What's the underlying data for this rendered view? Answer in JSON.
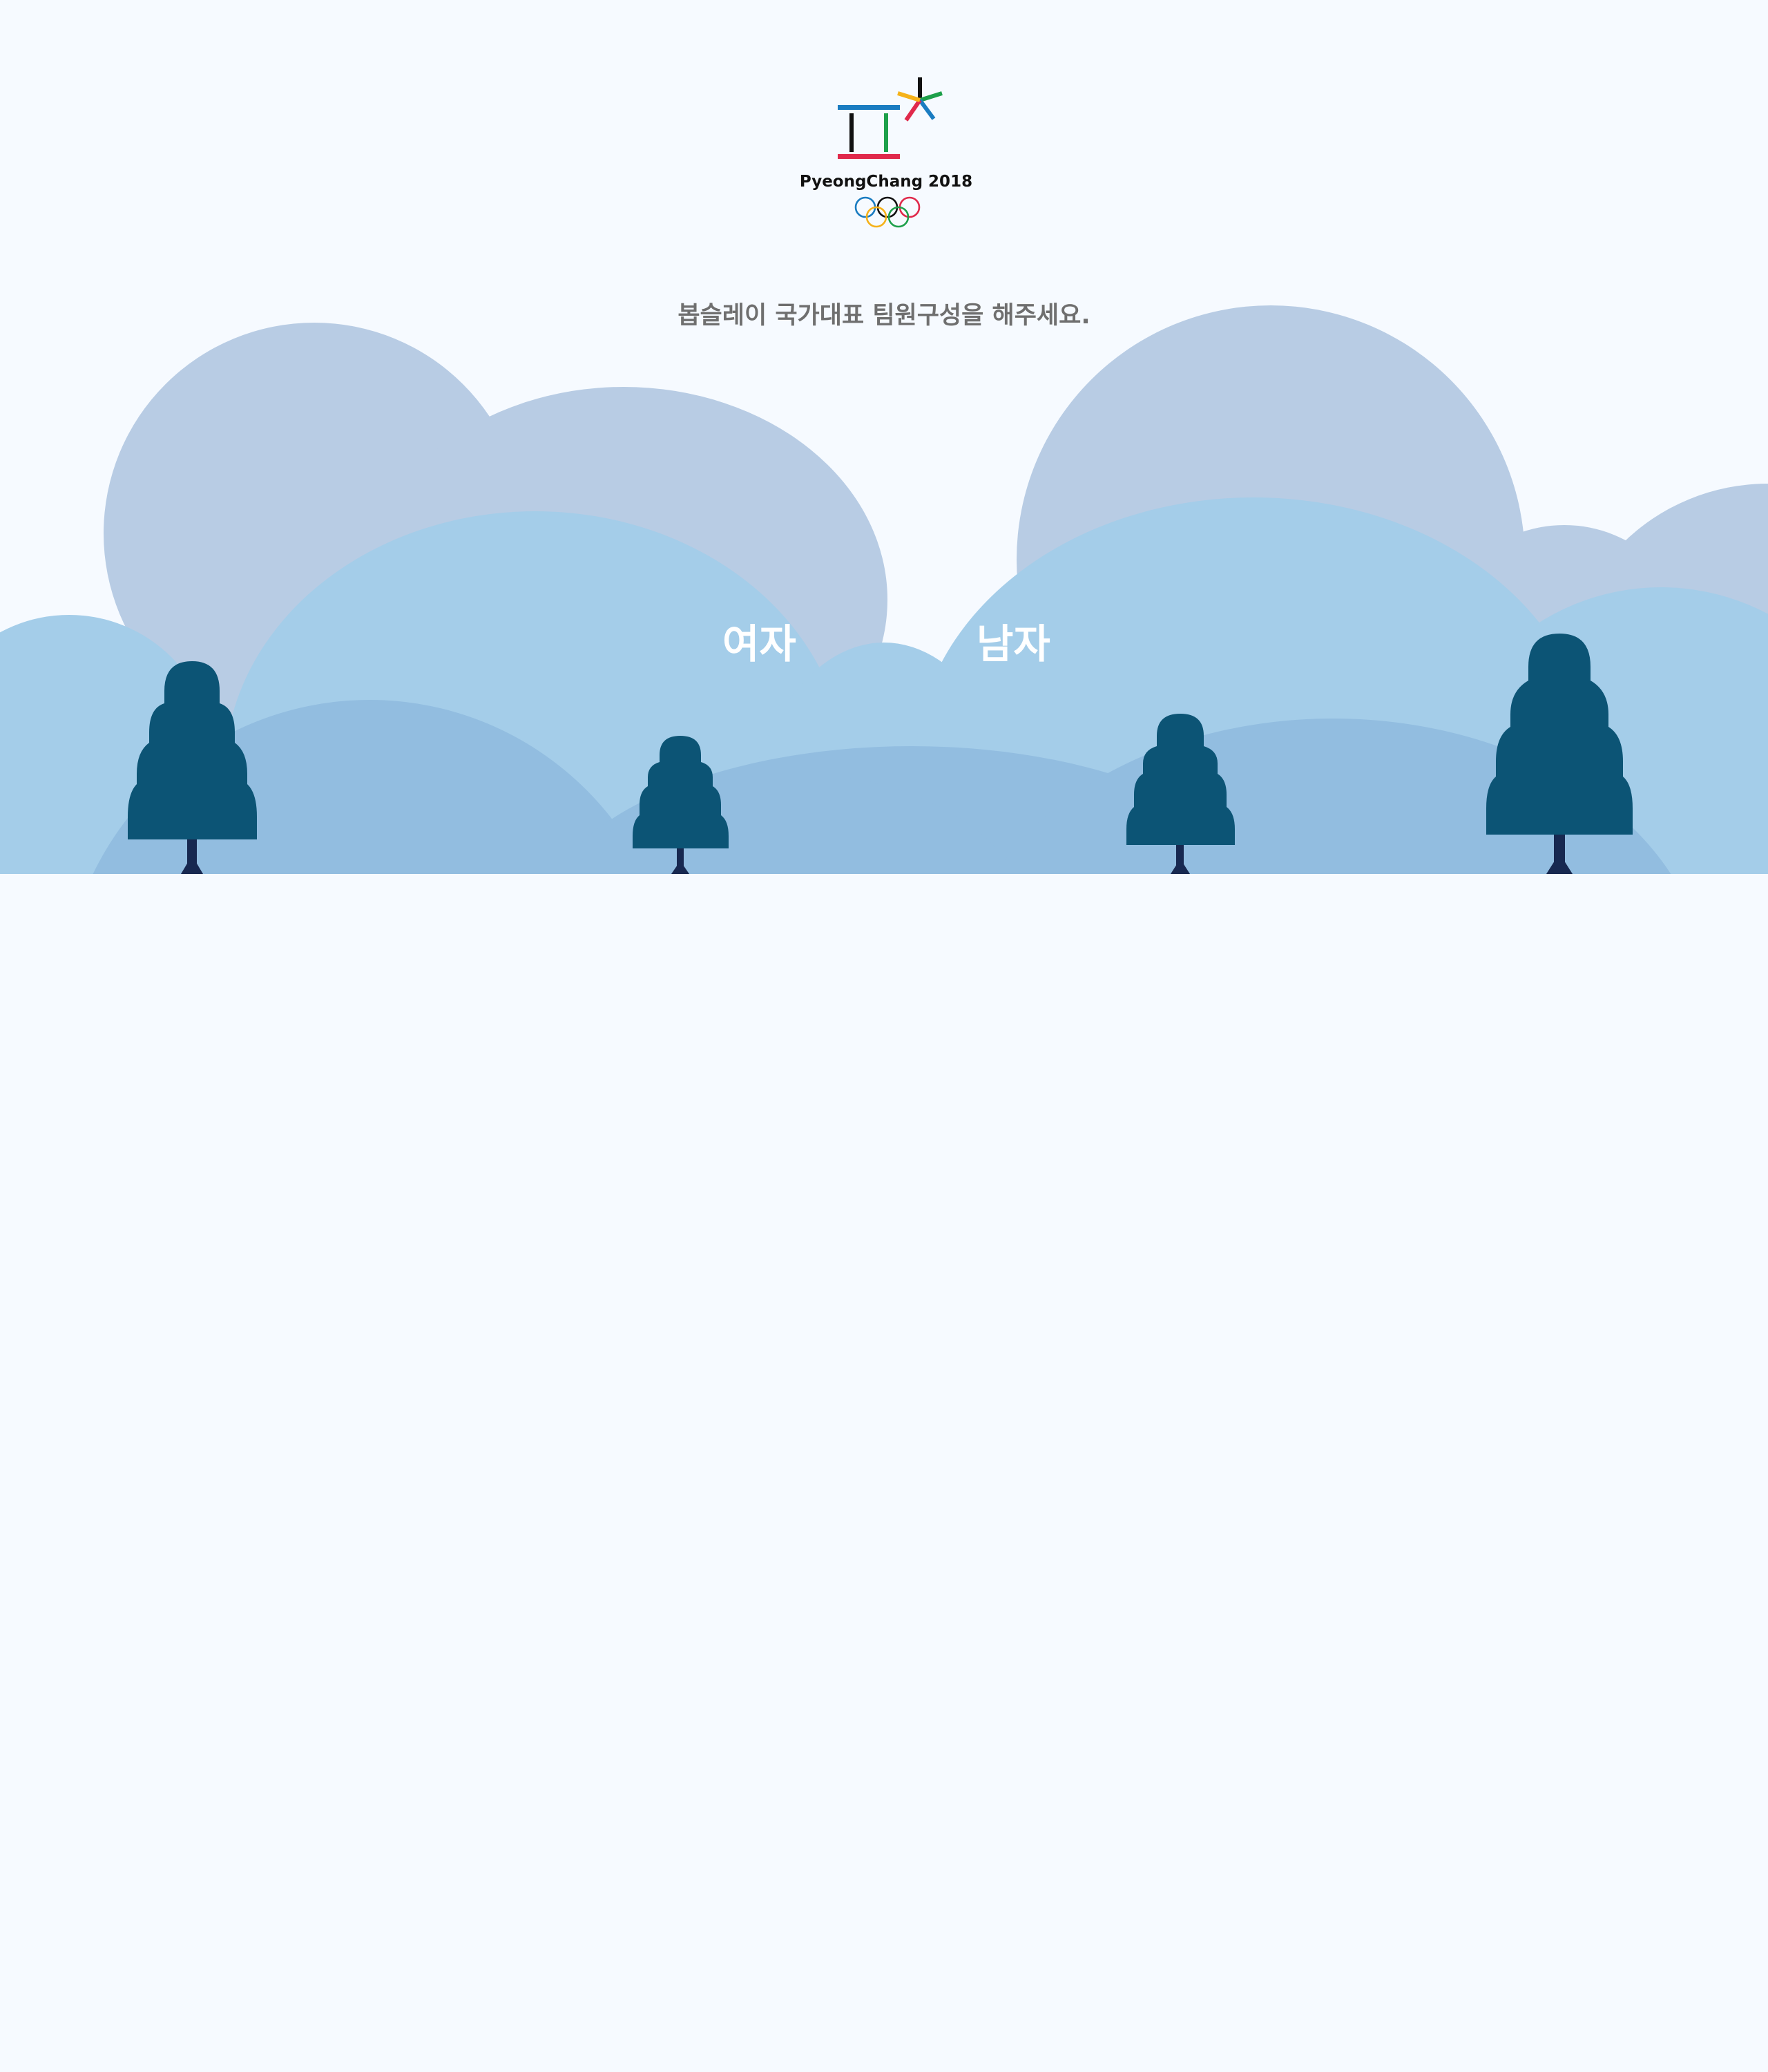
{
  "logo": {
    "icon": "pyeongchang-2018-emblem",
    "wordmark": "PyeongChang 2018",
    "rings_icon": "olympic-rings"
  },
  "prompt": "봅슬레이 국가대표 팀원구성을 해주세요.",
  "options": {
    "female_label": "여자",
    "male_label": "남자"
  },
  "colors": {
    "background": "#f6faff",
    "cloud_back": "#b8cce4",
    "cloud_mid": "#a4cde9",
    "hill_front": "#92bde0",
    "tree": "#0c5475",
    "tree_trunk": "#172850",
    "prompt_text": "#6f6f6f",
    "option_text": "#ffffff"
  }
}
